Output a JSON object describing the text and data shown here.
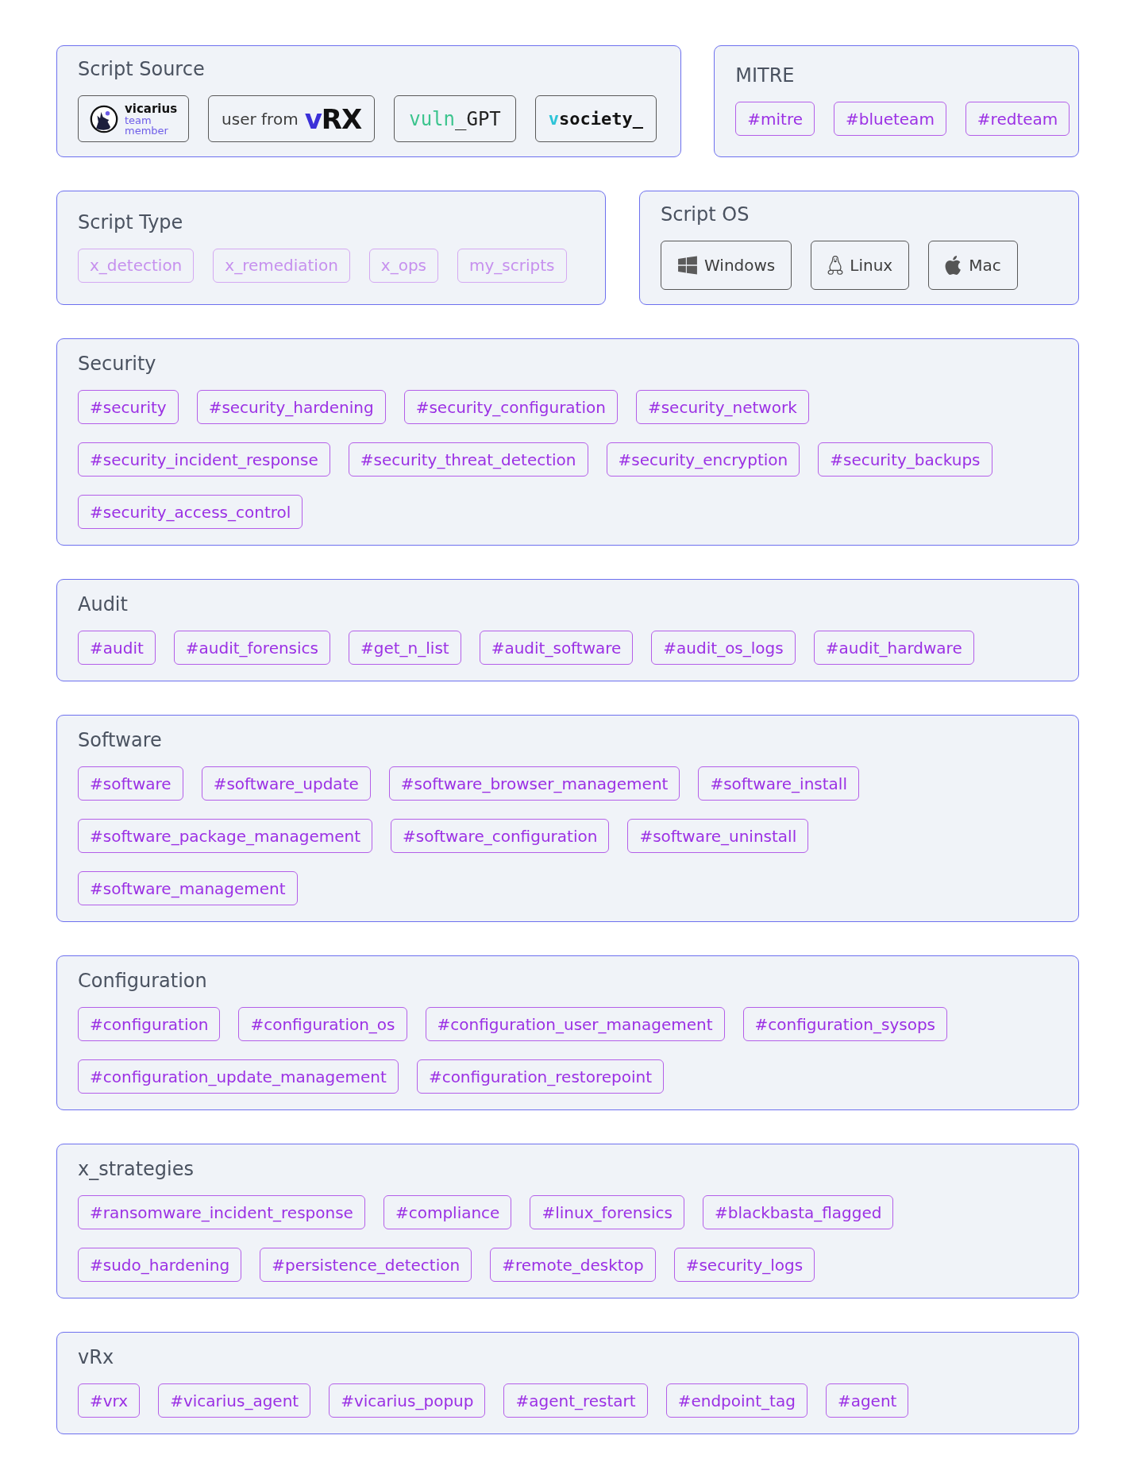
{
  "top": [
    {
      "title": "Script Source",
      "kind": "source",
      "items": [
        {
          "kind": "vicarius",
          "name": "vicarius",
          "caption": "team member"
        },
        {
          "kind": "vrx",
          "caption": "user from",
          "logo": [
            "v",
            "RX"
          ]
        },
        {
          "kind": "vuln_gpt",
          "logo": [
            "vuln",
            "_GPT"
          ]
        },
        {
          "kind": "vsociety",
          "logo": [
            "v",
            "society_"
          ]
        }
      ]
    },
    {
      "title": "MITRE",
      "kind": "tags",
      "tags": [
        "#mitre",
        "#blueteam",
        "#redteam"
      ]
    },
    {
      "title": "Script Type",
      "kind": "tags",
      "tags": [
        {
          "label": "x_detection",
          "disabled": true
        },
        {
          "label": "x_remediation",
          "disabled": true
        },
        {
          "label": "x_ops",
          "disabled": true
        },
        {
          "label": "my_scripts",
          "disabled": true
        }
      ]
    },
    {
      "title": "Script OS",
      "kind": "os",
      "items": [
        {
          "kind": "windows",
          "label": "Windows"
        },
        {
          "kind": "linux",
          "label": "Linux"
        },
        {
          "kind": "mac",
          "label": "Mac"
        }
      ]
    }
  ],
  "sections": [
    {
      "title": "Security",
      "tags": [
        "#security",
        "#security_hardening",
        "#security_configuration",
        "#security_network",
        "#security_incident_response",
        "#security_threat_detection",
        "#security_encryption",
        "#security_backups",
        "#security_access_control"
      ]
    },
    {
      "title": "Audit",
      "tags": [
        "#audit",
        "#audit_forensics",
        "#get_n_list",
        "#audit_software",
        "#audit_os_logs",
        "#audit_hardware"
      ]
    },
    {
      "title": "Software",
      "tags": [
        "#software",
        "#software_update",
        "#software_browser_management",
        "#software_install",
        "#software_package_management",
        "#software_configuration",
        "#software_uninstall",
        "#software_management"
      ]
    },
    {
      "title": "Configuration",
      "tags": [
        "#configuration",
        "#configuration_os",
        "#configuration_user_management",
        "#configuration_sysops",
        "#configuration_update_management",
        "#configuration_restorepoint"
      ]
    },
    {
      "title": "x_strategies",
      "tags": [
        "#ransomware_incident_response",
        "#compliance",
        "#linux_forensics",
        "#blackbasta_flagged",
        "#sudo_hardening",
        "#persistence_detection",
        "#remote_desktop",
        "#security_logs"
      ]
    },
    {
      "title": "vRx",
      "tags": [
        "#vrx",
        "#vicarius_agent",
        "#vicarius_popup",
        "#agent_restart",
        "#endpoint_tag",
        "#agent"
      ]
    }
  ]
}
